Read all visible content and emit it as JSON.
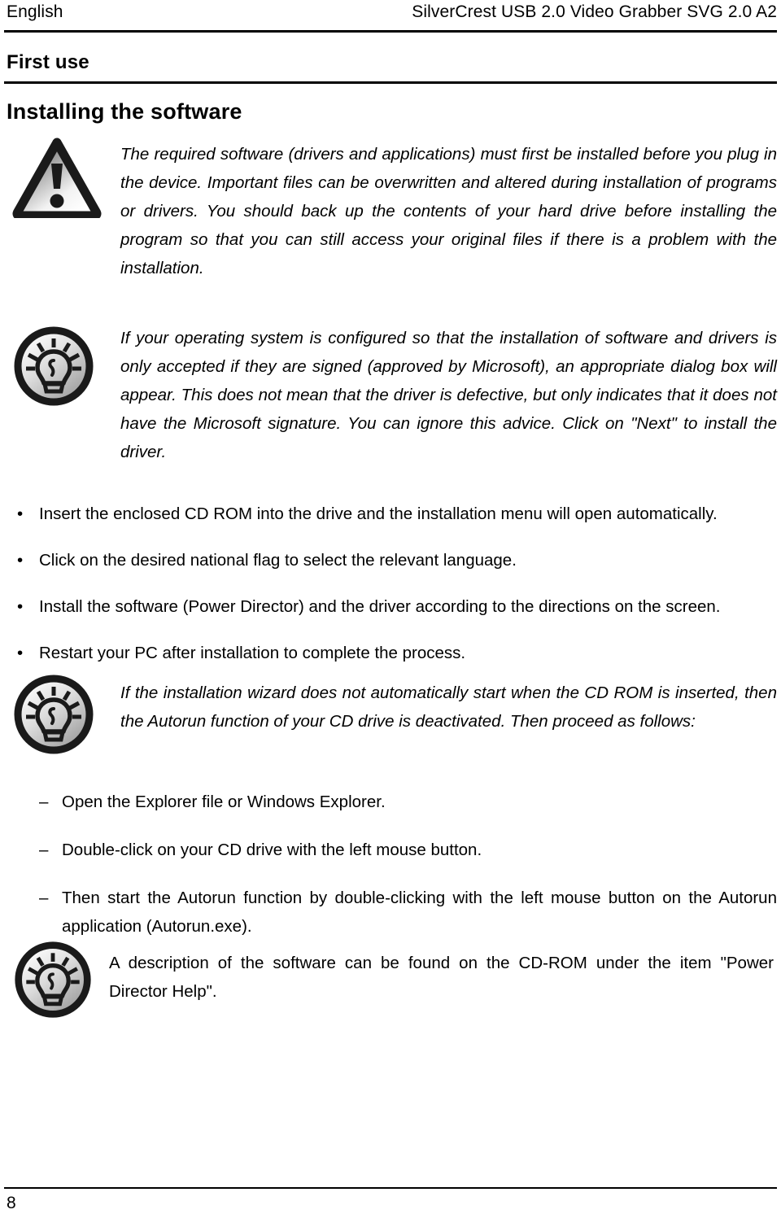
{
  "header": {
    "left": "English",
    "right": "SilverCrest USB 2.0 Video Grabber SVG 2.0 A2"
  },
  "headings": {
    "section": "First use",
    "subsection": "Installing the software"
  },
  "notes": {
    "warning": {
      "icon": "warning-triangle-icon",
      "text": "The required software (drivers and applications) must first be installed before you plug in the device. Important files can be overwritten and altered during installation of programs or drivers. You should back up the contents of your hard drive before installing the program so that you can still access your original files if there is a problem with the installation."
    },
    "signature": {
      "icon": "lightbulb-tip-icon",
      "text": "If your operating system is configured so that the installation of software and drivers is only accepted if they are signed (approved by Microsoft), an appropriate dialog box will appear. This does not mean that the driver is defective, but only indicates that it does not have the Microsoft signature. You can ignore this advice. Click on \"Next\" to install the driver."
    },
    "autorun": {
      "icon": "lightbulb-tip-icon",
      "text": "If the installation wizard does not automatically start when the CD ROM is inserted, then the Autorun function of your CD drive is deactivated. Then proceed as follows:"
    },
    "help": {
      "icon": "lightbulb-tip-icon",
      "text": "A description of the software can be found on the CD-ROM under the item \"Power Director Help\"."
    }
  },
  "bullet_list": {
    "marker": "•",
    "items": [
      "Insert the enclosed CD ROM into the drive and the installation menu will open automatically.",
      "Click on the desired national flag to select the relevant language.",
      "Install the software (Power Director) and the driver according to the directions on the screen.",
      "Restart your PC after installation to complete the process."
    ]
  },
  "dash_list": {
    "marker": "–",
    "items": [
      "Open the Explorer file or Windows Explorer.",
      "Double-click on your CD drive with the left mouse button.",
      "Then start the Autorun function by double-clicking with the left mouse button on the Autorun application (Autorun.exe)."
    ]
  },
  "footer": {
    "page_number": "8"
  },
  "colors": {
    "text": "#000000",
    "rule": "#000000",
    "icon_outline": "#1a1a1a",
    "icon_fill_light": "#ffffff",
    "icon_fill_dark": "#8c8c8c"
  }
}
